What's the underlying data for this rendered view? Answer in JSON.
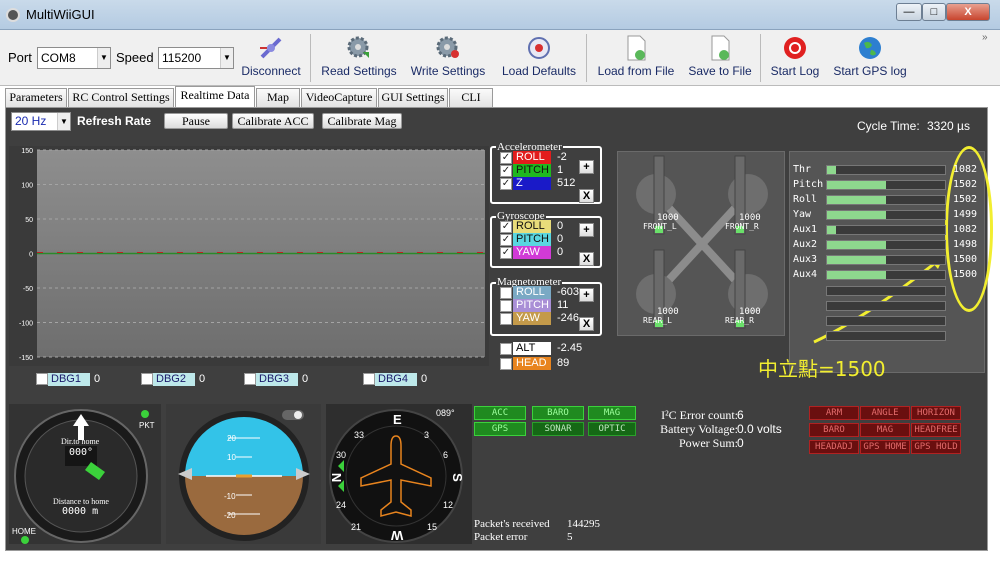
{
  "window": {
    "title": "MultiWiiGUI",
    "min": "—",
    "max": "□",
    "close": "X"
  },
  "toolbar": {
    "port_label": "Port",
    "port_value": "COM8",
    "speed_label": "Speed",
    "speed_value": "115200",
    "buttons": [
      "Disconnect",
      "Read Settings",
      "Write Settings",
      "Load Defaults",
      "Load from File",
      "Save to File",
      "Start Log",
      "Start GPS log"
    ]
  },
  "tabs": [
    "Parameters",
    "RC Control Settings",
    "Realtime Data",
    "Map",
    "VideoCapture",
    "GUI Settings",
    "CLI"
  ],
  "controls": {
    "refresh_value": "20 Hz",
    "refresh_label": "Refresh Rate",
    "pause": "Pause",
    "calib_acc": "Calibrate ACC",
    "calib_mag": "Calibrate Mag",
    "cycle_label": "Cycle Time:",
    "cycle_value": "3320 µs"
  },
  "graph": {
    "y_ticks": [
      "150",
      "100",
      "50",
      "0",
      "-50",
      "-100",
      "-150"
    ]
  },
  "debug": [
    {
      "label": "DBG1",
      "value": "0"
    },
    {
      "label": "DBG2",
      "value": "0"
    },
    {
      "label": "DBG3",
      "value": "0"
    },
    {
      "label": "DBG4",
      "value": "0"
    }
  ],
  "accelerometer": {
    "title": "Accelerometer",
    "rows": [
      {
        "name": "ROLL",
        "value": "-2",
        "color": "#e21c1c"
      },
      {
        "name": "PITCH",
        "value": "1",
        "color": "#1fb81f"
      },
      {
        "name": "Z",
        "value": "512",
        "color": "#1a1ac8"
      }
    ]
  },
  "gyroscope": {
    "title": "Gyroscope",
    "rows": [
      {
        "name": "ROLL",
        "value": "0",
        "color": "#e8dc7a"
      },
      {
        "name": "PITCH",
        "value": "0",
        "color": "#5ad6e0"
      },
      {
        "name": "YAW",
        "value": "0",
        "color": "#d13ad6"
      }
    ]
  },
  "magnetometer": {
    "title": "Magnetometer",
    "rows": [
      {
        "name": "ROLL",
        "value": "-603",
        "color": "#7aa9c4"
      },
      {
        "name": "PITCH",
        "value": "11",
        "color": "#a98fd6"
      },
      {
        "name": "YAW",
        "value": "-246",
        "color": "#c49a4a"
      }
    ]
  },
  "alt": {
    "name": "ALT",
    "value": "-2.45"
  },
  "head": {
    "name": "HEAD",
    "value": "89"
  },
  "motors": [
    {
      "label": "FRONT_L",
      "value": "1000"
    },
    {
      "label": "FRONT_R",
      "value": "1000"
    },
    {
      "label": "REAR_L",
      "value": "1000"
    },
    {
      "label": "REAR_R",
      "value": "1000"
    }
  ],
  "rc": [
    {
      "name": "Thr",
      "value": "1082",
      "fill": 0.08
    },
    {
      "name": "Pitch",
      "value": "1502",
      "fill": 0.5
    },
    {
      "name": "Roll",
      "value": "1502",
      "fill": 0.5
    },
    {
      "name": "Yaw",
      "value": "1499",
      "fill": 0.5
    },
    {
      "name": "Aux1",
      "value": "1082",
      "fill": 0.08
    },
    {
      "name": "Aux2",
      "value": "1498",
      "fill": 0.5
    },
    {
      "name": "Aux3",
      "value": "1500",
      "fill": 0.5
    },
    {
      "name": "Aux4",
      "value": "1500",
      "fill": 0.5
    }
  ],
  "annotation": "中立點=1500",
  "sensors": [
    "ACC",
    "BARO",
    "MAG",
    "GPS",
    "SONAR",
    "OPTIC"
  ],
  "status": {
    "i2c_label": "I²C Error count:",
    "i2c_value": "6",
    "batt_label": "Battery Voltage:",
    "batt_value": "0.0 volts",
    "power_label": "Power Sum:",
    "power_value": "0",
    "pkt_recv_label": "Packet's received",
    "pkt_recv_value": "144295",
    "pkt_err_label": "Packet error",
    "pkt_err_value": "5"
  },
  "modes": [
    "ARM",
    "ANGLE",
    "HORIZON",
    "BARO",
    "MAG",
    "HEADFREE",
    "HEADADJ",
    "GPS HOME",
    "GPS HOLD"
  ],
  "gps": {
    "pkt": "PKT",
    "dir_label": "Dir.to home",
    "dir_value": "000°",
    "dist_label": "Distance to home",
    "dist_value": "0000 m",
    "home": "HOME"
  },
  "horizon": {
    "ticks": [
      "20",
      "10",
      "10",
      "-10",
      "-20"
    ]
  },
  "compass": {
    "heading": "089°",
    "labels": {
      "n": "N",
      "e": "E",
      "s": "S",
      "w": "W"
    },
    "nums": [
      "3",
      "6",
      "12",
      "15",
      "21",
      "24",
      "30",
      "33"
    ]
  }
}
